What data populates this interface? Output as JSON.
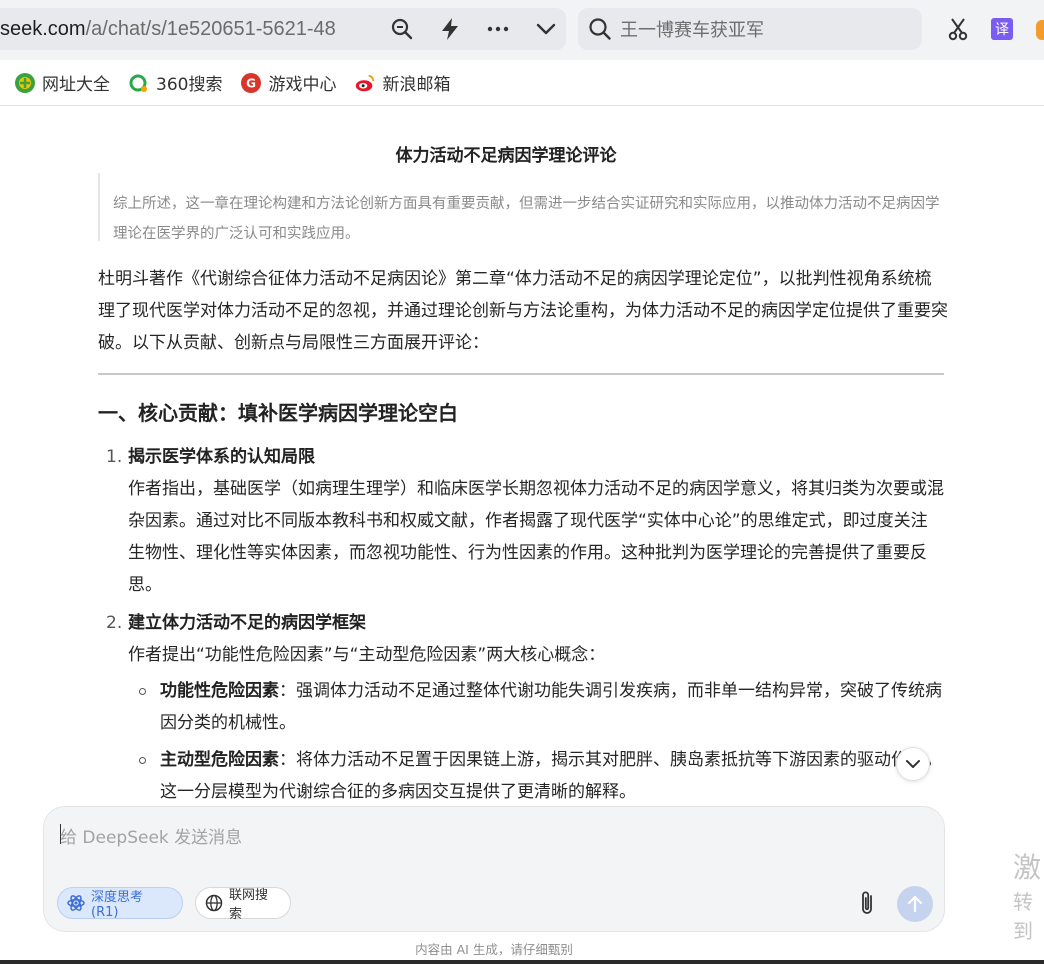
{
  "browser": {
    "url_domain": "seek.com",
    "url_path": "/a/chat/s/1e520651-5621-48",
    "search_text": "王一博赛车获亚军",
    "translate_label": "译"
  },
  "bookmarks": [
    {
      "label": "网址大全",
      "icon": "wangzhi-icon"
    },
    {
      "label": "360搜索",
      "icon": "360-search-icon"
    },
    {
      "label": "游戏中心",
      "icon": "game-center-icon"
    },
    {
      "label": "新浪邮箱",
      "icon": "sina-mail-icon"
    }
  ],
  "document": {
    "title": "体力活动不足病因学理论评论",
    "quote": "综上所述，这一章在理论构建和方法论创新方面具有重要贡献，但需进一步结合实证研究和实际应用，以推动体力活动不足病因学理论在医学界的广泛认可和实践应用。",
    "intro": "杜明斗著作《代谢综合征体力活动不足病因论》第二章“体力活动不足的病因学理论定位”，以批判性视角系统梳理了现代医学对体力活动不足的忽视，并通过理论创新与方法论重构，为体力活动不足的病因学定位提供了重要突破。以下从贡献、创新点与局限性三方面展开评论：",
    "section1_heading": "一、核心贡献：填补医学病因学理论空白",
    "items": [
      {
        "num": "1.",
        "heading": "揭示医学体系的认知局限",
        "body": "作者指出，基础医学（如病理生理学）和临床医学长期忽视体力活动不足的病因学意义，将其归类为次要或混杂因素。通过对比不同版本教科书和权威文献，作者揭露了现代医学“实体中心论”的思维定式，即过度关注生物性、理化性等实体因素，而忽视功能性、行为性因素的作用。这种批判为医学理论的完善提供了重要反思。"
      },
      {
        "num": "2.",
        "heading": "建立体力活动不足的病因学框架",
        "body": "作者提出“功能性危险因素”与“主动型危险因素”两大核心概念："
      }
    ],
    "bullets": [
      {
        "term": "功能性危险因素",
        "text": "：强调体力活动不足通过整体代谢功能失调引发疾病，而非单一结构异常，突破了传统病因分类的机械性。"
      },
      {
        "term": "主动型危险因素",
        "text": "：将体力活动不足置于因果链上游，揭示其对肥胖、胰岛素抵抗等下游因素的驱动作用。这一分层模型为代谢综合征的多病因交互提供了更清晰的解释。"
      }
    ]
  },
  "composer": {
    "placeholder": "给 DeepSeek 发送消息",
    "deep_think_label": "深度思考 (R1)",
    "web_search_label": "联网搜索"
  },
  "disclaimer": "内容由 AI 生成，请仔细甄别",
  "watermark": {
    "line1": "激",
    "line2": "转到"
  },
  "colors": {
    "accent": "#3d6fd6",
    "send_disabled": "#c5d3ee"
  }
}
